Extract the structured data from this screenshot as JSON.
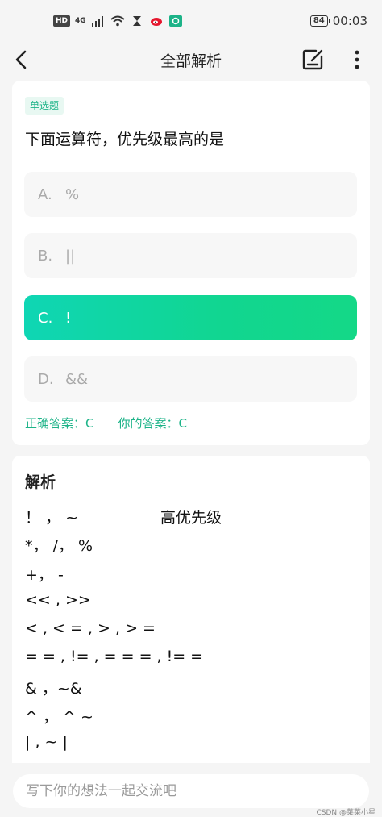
{
  "status_bar": {
    "hd": "HD",
    "network": "4G",
    "battery": "84",
    "time": "00:03"
  },
  "header": {
    "title": "全部解析"
  },
  "question": {
    "type_label": "单选题",
    "text": "下面运算符，优先级最高的是",
    "options": [
      {
        "letter": "A.",
        "text": "%",
        "selected": false
      },
      {
        "letter": "B.",
        "text": "||",
        "selected": false
      },
      {
        "letter": "C.",
        "text": "!",
        "selected": true
      },
      {
        "letter": "D.",
        "text": "&&",
        "selected": false
      }
    ],
    "correct_answer": "正确答案：C",
    "your_answer": "你的答案：C"
  },
  "analysis": {
    "title": "解析",
    "high_priority_note": "高优先级",
    "lines": [
      "！ ， ~",
      "*， /， %",
      "+， -",
      "<< , >>",
      "< , < = , > , > =",
      "= = , != , = = = , != =",
      "& ，~&",
      "^ ， ^ ~",
      "| , ~ |"
    ]
  },
  "comment": {
    "placeholder": "写下你的想法一起交流吧"
  },
  "watermark": "CSDN @菜菜小星",
  "colors": {
    "accent": "#1db388",
    "selected_gradient_start": "#0fd6b4",
    "selected_gradient_end": "#14d887"
  }
}
